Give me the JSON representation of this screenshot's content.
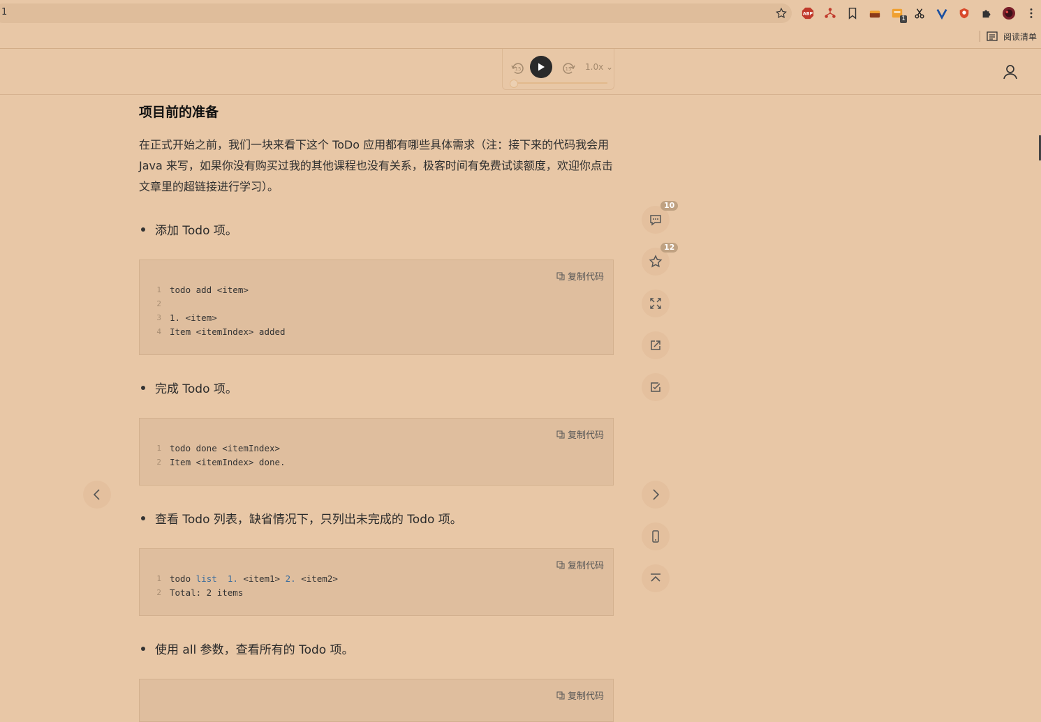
{
  "browser": {
    "address_text": "1",
    "reading_list_label": "阅读清单",
    "extensions": [
      {
        "name": "abp",
        "label": "ABP"
      },
      {
        "name": "tree",
        "label": ""
      },
      {
        "name": "bookmark",
        "label": ""
      },
      {
        "name": "cake",
        "label": ""
      },
      {
        "name": "notes",
        "label": "",
        "badge": "1"
      },
      {
        "name": "cut",
        "label": ""
      },
      {
        "name": "vee",
        "label": ""
      },
      {
        "name": "shield",
        "label": ""
      },
      {
        "name": "puzzle",
        "label": ""
      },
      {
        "name": "avatar",
        "label": ""
      },
      {
        "name": "menu",
        "label": ""
      }
    ]
  },
  "player": {
    "rewind_label": "15",
    "forward_label": "15",
    "speed": "1.0x",
    "progress": 0.0
  },
  "article": {
    "heading": "项目前的准备",
    "intro": "在正式开始之前，我们一块来看下这个 ToDo 应用都有哪些具体需求（注：接下来的代码我会用 Java 来写，如果你没有购买过我的其他课程也没有关系，极客时间有免费试读额度，欢迎你点击文章里的超链接进行学习）。",
    "copy_label": "复制代码",
    "sections": [
      {
        "bullet": "添加 Todo 项。",
        "code": [
          {
            "n": "1",
            "text": "todo add <item>"
          },
          {
            "n": "2",
            "text": ""
          },
          {
            "n": "3",
            "text": "1. <item>"
          },
          {
            "n": "4",
            "text": "Item <itemIndex> added"
          }
        ]
      },
      {
        "bullet": "完成 Todo 项。",
        "code": [
          {
            "n": "1",
            "text": "todo done <itemIndex>"
          },
          {
            "n": "2",
            "text": "Item <itemIndex> done."
          }
        ]
      },
      {
        "bullet": "查看 Todo 列表，缺省情况下，只列出未完成的 Todo 项。",
        "code": [
          {
            "n": "1",
            "text": "todo list  1. <item1> 2. <item2>"
          },
          {
            "n": "2",
            "text": "Total: 2 items"
          }
        ]
      },
      {
        "bullet": "使用 all 参数，查看所有的 Todo 项。"
      }
    ]
  },
  "tools": {
    "comments_count": "10",
    "favorites_count": "12"
  },
  "colors": {
    "background": "#e8c7a6",
    "code_bg": "#dfbe9e",
    "badge": "#bfa181"
  }
}
